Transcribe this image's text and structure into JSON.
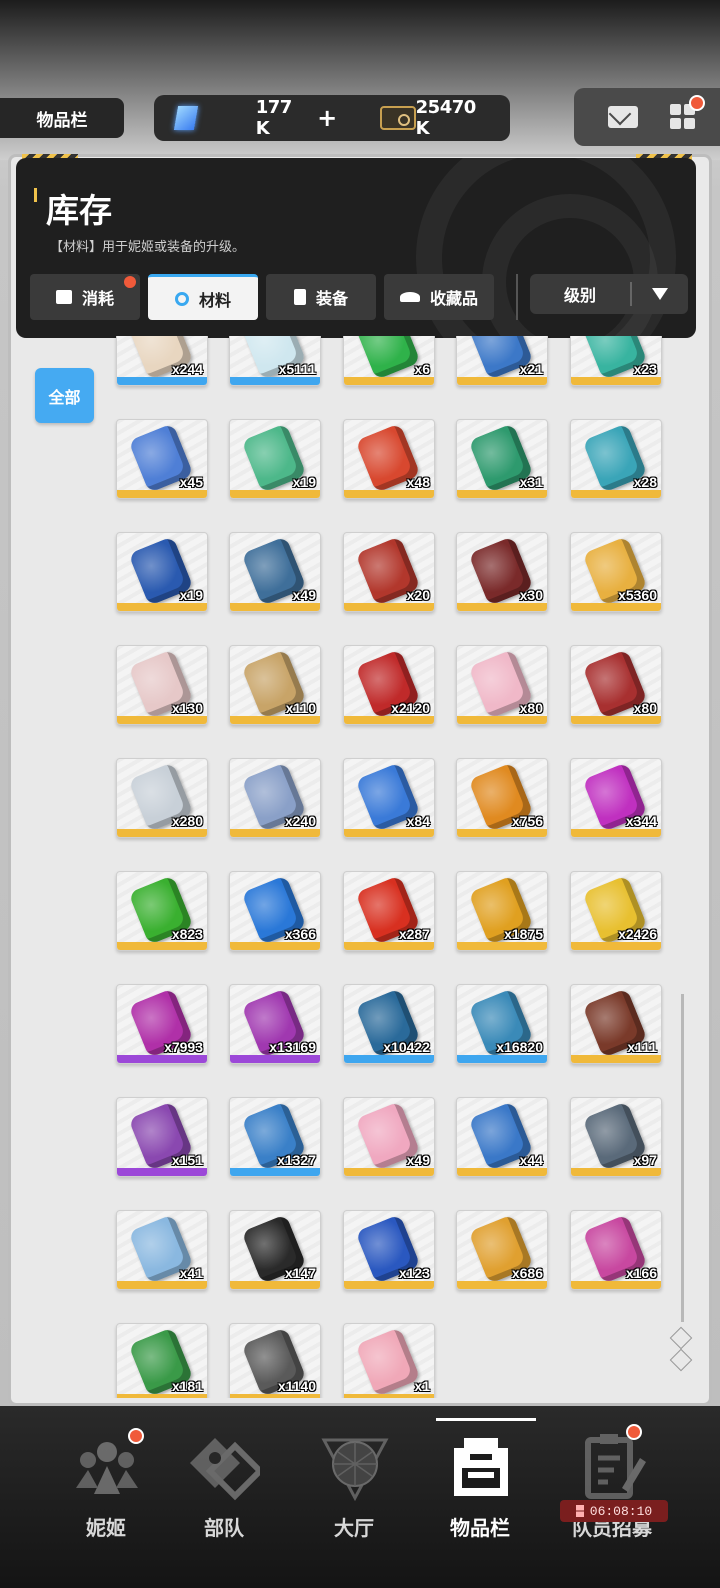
{
  "header": {
    "page_tab": "物品栏",
    "gems": "177 K",
    "add_symbol": "+",
    "credits": "25470 K",
    "mail_icon": "mail-icon",
    "menu_icon": "grid-menu-icon"
  },
  "inventory": {
    "title": "库存",
    "description": "【材料】用于妮姬或装备的升级。",
    "tabs": [
      {
        "label": "消耗",
        "active": false,
        "badge": true
      },
      {
        "label": "材料",
        "active": true,
        "badge": false
      },
      {
        "label": "装备",
        "active": false,
        "badge": false
      },
      {
        "label": "收藏品",
        "active": false,
        "badge": false
      }
    ],
    "sort": {
      "label": "级别"
    },
    "filter_all": "全部"
  },
  "colors": {
    "accent": "#45aaf2",
    "rarity_gold": "#f0b93a",
    "rarity_blue": "#3ea6ef",
    "rarity_purple": "#9c48d8",
    "badge_red": "#f05a3a"
  },
  "items": [
    {
      "count": "x244",
      "rarity": "blue",
      "color": "#e8d6c0"
    },
    {
      "count": "x5111",
      "rarity": "blue",
      "color": "#cfe7ef"
    },
    {
      "count": "x6",
      "rarity": "gold",
      "color": "#2fb24a"
    },
    {
      "count": "x21",
      "rarity": "gold",
      "color": "#3c78c8"
    },
    {
      "count": "x23",
      "rarity": "gold",
      "color": "#38b4a0"
    },
    {
      "count": "x45",
      "rarity": "gold",
      "color": "#4f7fd6"
    },
    {
      "count": "x19",
      "rarity": "gold",
      "color": "#4db88a"
    },
    {
      "count": "x48",
      "rarity": "gold",
      "color": "#d8482f"
    },
    {
      "count": "x31",
      "rarity": "gold",
      "color": "#2e9a6e"
    },
    {
      "count": "x28",
      "rarity": "gold",
      "color": "#3aa5b8"
    },
    {
      "count": "x19",
      "rarity": "gold",
      "color": "#2a5ab0"
    },
    {
      "count": "x49",
      "rarity": "gold",
      "color": "#3f6f9a"
    },
    {
      "count": "x20",
      "rarity": "gold",
      "color": "#b2372c"
    },
    {
      "count": "x30",
      "rarity": "gold",
      "color": "#7a2a2a"
    },
    {
      "count": "x5360",
      "rarity": "gold",
      "color": "#e8b040"
    },
    {
      "count": "x130",
      "rarity": "gold",
      "color": "#e6c8c8"
    },
    {
      "count": "x110",
      "rarity": "gold",
      "color": "#c8a468"
    },
    {
      "count": "x2120",
      "rarity": "gold",
      "color": "#c02a2a"
    },
    {
      "count": "x80",
      "rarity": "gold",
      "color": "#f0b8c8"
    },
    {
      "count": "x80",
      "rarity": "gold",
      "color": "#a83030"
    },
    {
      "count": "x280",
      "rarity": "gold",
      "color": "#c8d0d8"
    },
    {
      "count": "x240",
      "rarity": "gold",
      "color": "#8aa0c8"
    },
    {
      "count": "x84",
      "rarity": "gold",
      "color": "#3a7ad8"
    },
    {
      "count": "x756",
      "rarity": "gold",
      "color": "#e08a20"
    },
    {
      "count": "x344",
      "rarity": "gold",
      "color": "#c030c0"
    },
    {
      "count": "x823",
      "rarity": "gold",
      "color": "#3ab030"
    },
    {
      "count": "x366",
      "rarity": "gold",
      "color": "#2a78d8"
    },
    {
      "count": "x287",
      "rarity": "gold",
      "color": "#d83020"
    },
    {
      "count": "x1875",
      "rarity": "gold",
      "color": "#e0a020"
    },
    {
      "count": "x2426",
      "rarity": "gold",
      "color": "#e8c030"
    },
    {
      "count": "x7993",
      "rarity": "purple",
      "color": "#b030a8"
    },
    {
      "count": "x13169",
      "rarity": "purple",
      "color": "#a038b0"
    },
    {
      "count": "x10422",
      "rarity": "blue",
      "color": "#2a6a9a"
    },
    {
      "count": "x16820",
      "rarity": "blue",
      "color": "#3a8ab8"
    },
    {
      "count": "x111",
      "rarity": "gold",
      "color": "#7a3a2a"
    },
    {
      "count": "x151",
      "rarity": "purple",
      "color": "#8a48b0"
    },
    {
      "count": "x1327",
      "rarity": "blue",
      "color": "#3a80c8"
    },
    {
      "count": "x49",
      "rarity": "gold",
      "color": "#f0a8c0"
    },
    {
      "count": "x44",
      "rarity": "gold",
      "color": "#3a78c8"
    },
    {
      "count": "x97",
      "rarity": "gold",
      "color": "#5a6a7a"
    },
    {
      "count": "x41",
      "rarity": "gold",
      "color": "#8ab8e0"
    },
    {
      "count": "x147",
      "rarity": "gold",
      "color": "#2a2a2a"
    },
    {
      "count": "x123",
      "rarity": "gold",
      "color": "#2a58c0"
    },
    {
      "count": "x686",
      "rarity": "gold",
      "color": "#e0a030"
    },
    {
      "count": "x166",
      "rarity": "gold",
      "color": "#c848a0"
    },
    {
      "count": "x181",
      "rarity": "gold",
      "color": "#3a9a48"
    },
    {
      "count": "x1140",
      "rarity": "gold",
      "color": "#5a5a5a"
    },
    {
      "count": "x1",
      "rarity": "gold",
      "color": "#f0a8b8"
    }
  ],
  "nav": {
    "items": [
      {
        "label": "妮姬",
        "icon": "nikke-group-icon",
        "badge": true,
        "active": false
      },
      {
        "label": "部队",
        "icon": "squad-icon",
        "badge": false,
        "active": false
      },
      {
        "label": "大厅",
        "icon": "lobby-icon",
        "badge": false,
        "active": false
      },
      {
        "label": "物品栏",
        "icon": "inventory-icon",
        "badge": false,
        "active": true
      },
      {
        "label": "队员招募",
        "icon": "recruit-icon",
        "badge": true,
        "active": false
      }
    ],
    "timer": "06:08:10"
  }
}
